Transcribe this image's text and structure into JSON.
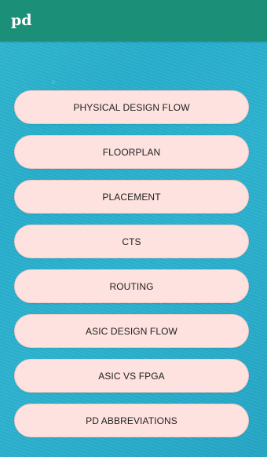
{
  "app_bar": {
    "title": "pd"
  },
  "menu": {
    "items": [
      {
        "label": "PHYSICAL DESIGN FLOW"
      },
      {
        "label": "FLOORPLAN"
      },
      {
        "label": "PLACEMENT"
      },
      {
        "label": "CTS"
      },
      {
        "label": "ROUTING"
      },
      {
        "label": "ASIC DESIGN FLOW"
      },
      {
        "label": "ASIC VS FPGA"
      },
      {
        "label": "PD ABBREVIATIONS"
      }
    ]
  }
}
